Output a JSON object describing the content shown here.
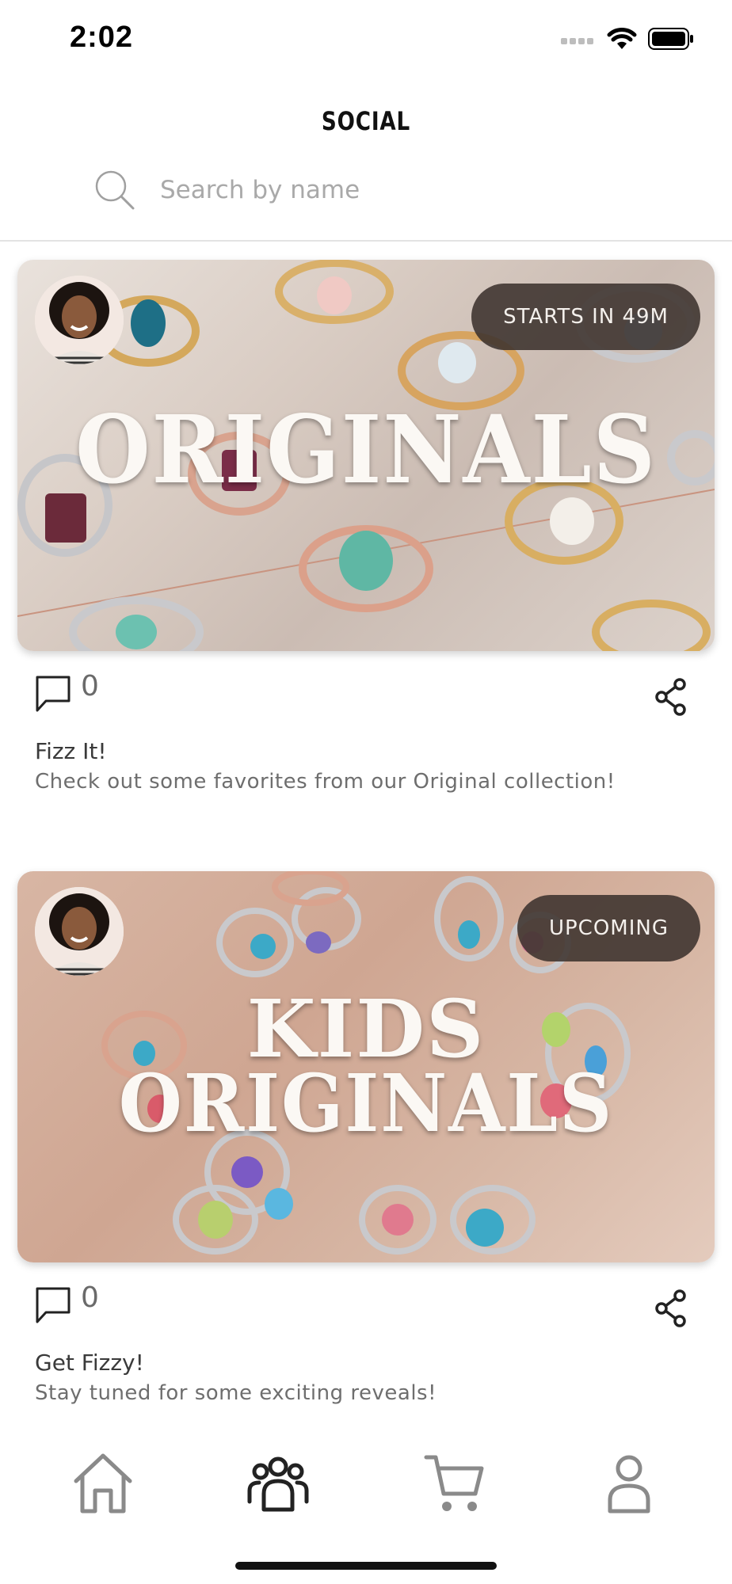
{
  "status": {
    "time": "2:02"
  },
  "header": {
    "title": "SOCIAL"
  },
  "search": {
    "placeholder": "Search by name"
  },
  "posts": [
    {
      "card_title_lines": [
        "ORIGINALS"
      ],
      "badge": "STARTS IN 49M",
      "comment_count": "0",
      "title": "Fizz It!",
      "description": "Check out some favorites from our Original collection!"
    },
    {
      "card_title_lines": [
        "KIDS",
        "ORIGINALS"
      ],
      "badge": "UPCOMING",
      "comment_count": "0",
      "title": "Get Fizzy!",
      "description": "Stay tuned for some exciting reveals!"
    }
  ],
  "tabs": [
    {
      "icon": "home-icon",
      "active": false
    },
    {
      "icon": "social-group-icon",
      "active": true
    },
    {
      "icon": "cart-icon",
      "active": false
    },
    {
      "icon": "profile-icon",
      "active": false
    }
  ],
  "colors": {
    "badge_bg": "#3c322d",
    "icon_inactive": "#8a8a8a",
    "icon_active": "#222222"
  }
}
